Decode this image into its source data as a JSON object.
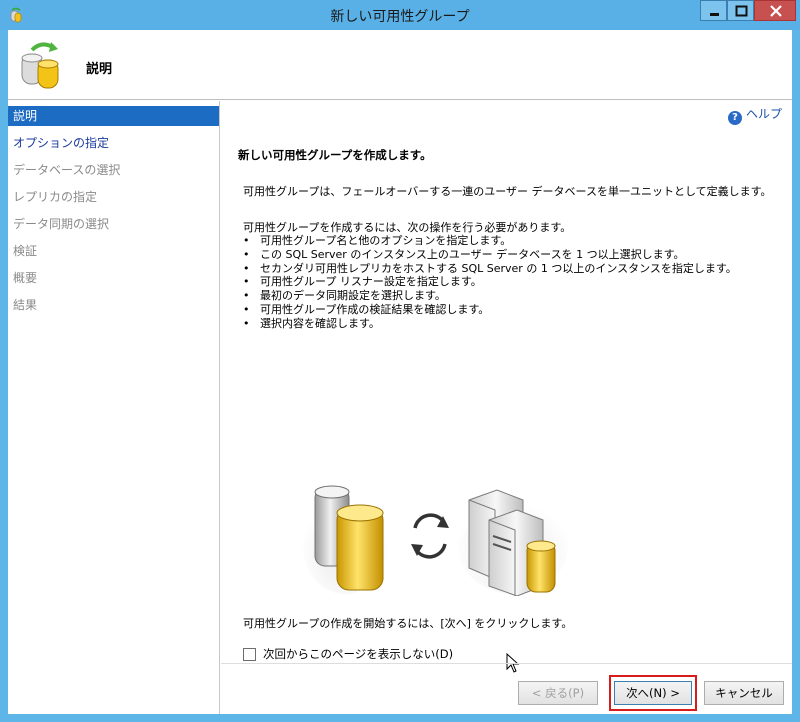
{
  "window": {
    "title": "新しい可用性グループ"
  },
  "header": {
    "title": "説明",
    "icon": "database-sync-icon"
  },
  "sidebar": {
    "items": [
      {
        "label": "説明",
        "state": "active"
      },
      {
        "label": "オプションの指定",
        "state": "link"
      },
      {
        "label": "データベースの選択",
        "state": "disabled"
      },
      {
        "label": "レプリカの指定",
        "state": "disabled"
      },
      {
        "label": "データ同期の選択",
        "state": "disabled"
      },
      {
        "label": "検証",
        "state": "disabled"
      },
      {
        "label": "概要",
        "state": "disabled"
      },
      {
        "label": "結果",
        "state": "disabled"
      }
    ]
  },
  "main": {
    "help_label": "ヘルプ",
    "heading": "新しい可用性グループを作成します。",
    "intro": "可用性グループは、フェールオーバーする一連のユーザー データベースを単一ユニットとして定義します。",
    "steps_heading": "可用性グループを作成するには、次の操作を行う必要があります。",
    "steps": [
      "可用性グループ名と他のオプションを指定します。",
      "この SQL Server のインスタンス上のユーザー データベースを 1 つ以上選択します。",
      "セカンダリ可用性レプリカをホストする SQL Server の 1 つ以上のインスタンスを指定します。",
      "可用性グループ リスナー設定を指定します。",
      "最初のデータ同期設定を選択します。",
      "可用性グループ作成の検証結果を確認します。",
      "選択内容を確認します。"
    ],
    "start_hint": "可用性グループの作成を開始するには、[次へ] をクリックします。",
    "dont_show_label": "次回からこのページを表示しない(D)",
    "dont_show_checked": false
  },
  "buttons": {
    "back": "< 戻る(P)",
    "next": "次へ(N) >",
    "cancel": "キャンセル"
  },
  "colors": {
    "titlebar": "#58b0e6",
    "active_nav": "#1c6cc4",
    "highlight": "#d81b1b"
  }
}
